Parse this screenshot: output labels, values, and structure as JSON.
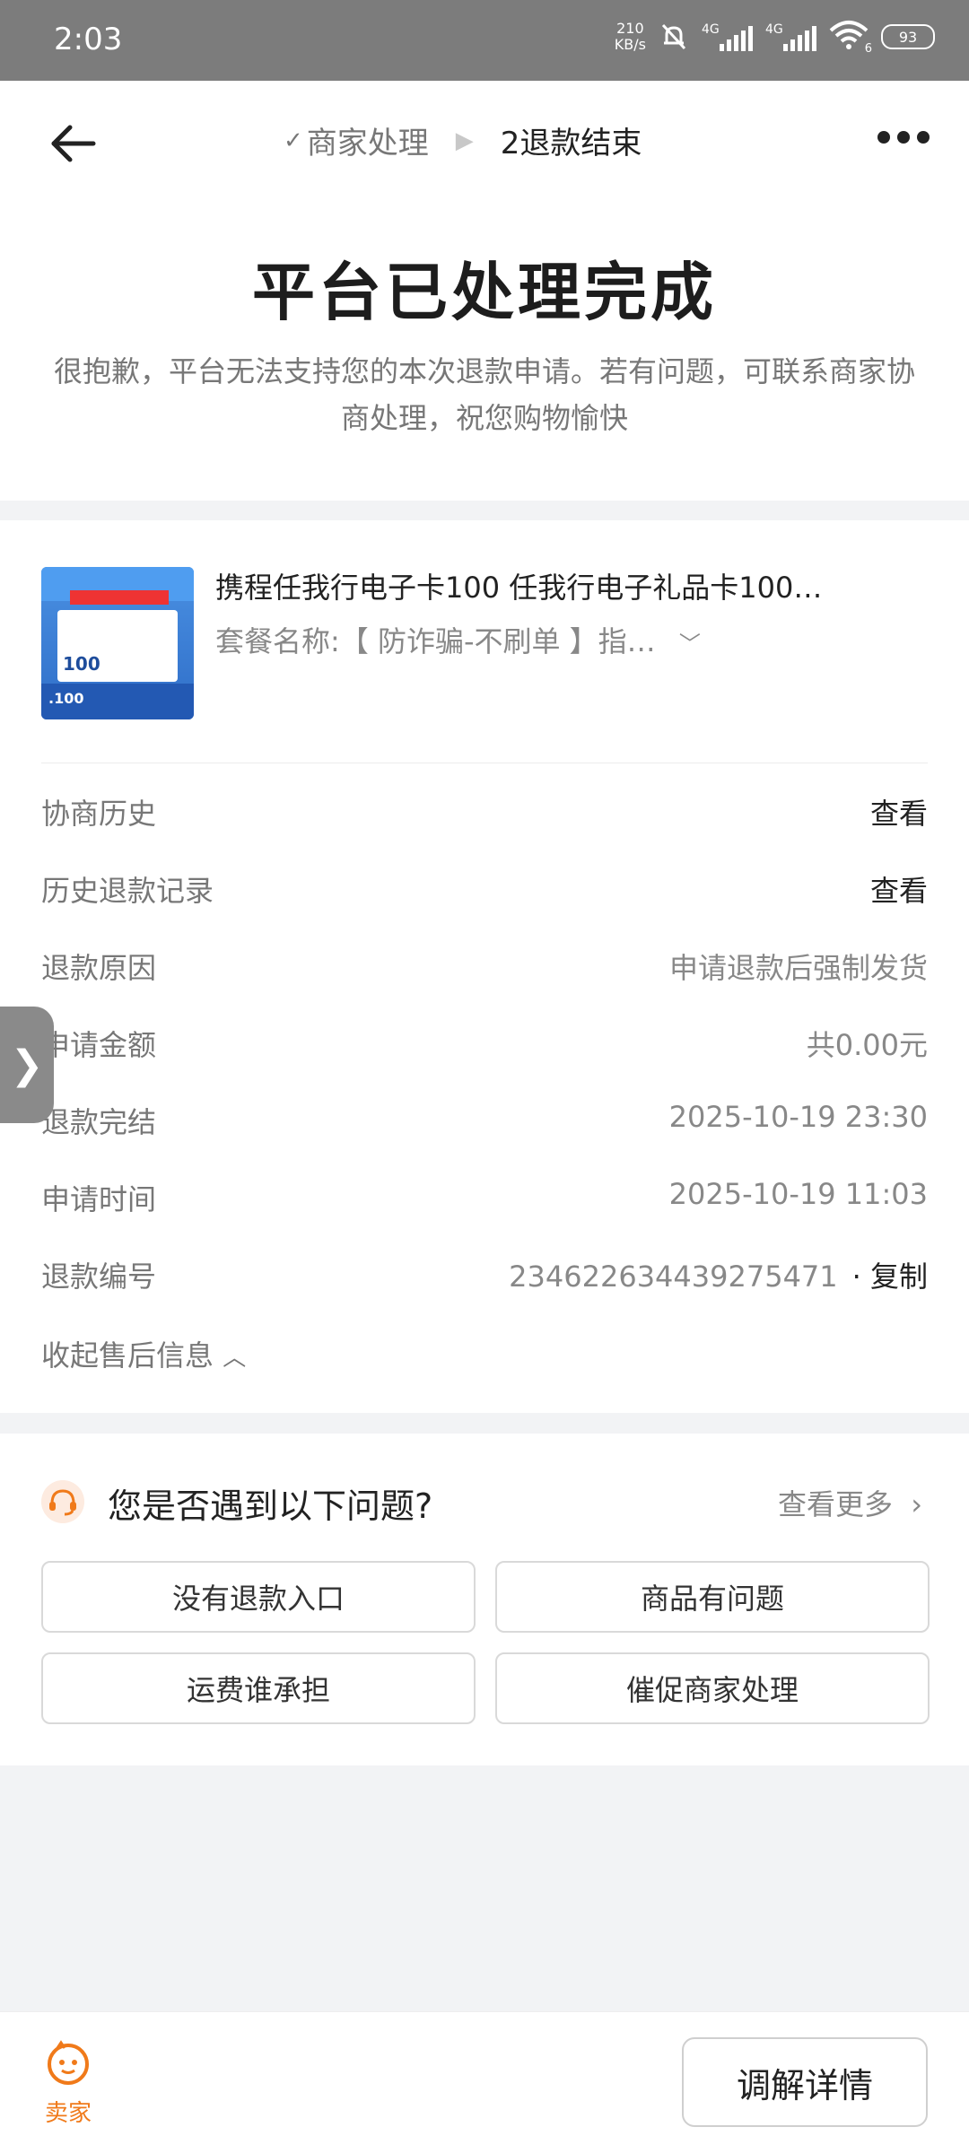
{
  "status_bar": {
    "time": "2:03",
    "net_speed_value": "210",
    "net_speed_unit": "KB/s",
    "signal1_label": "4G",
    "signal2_label": "4G",
    "wifi_label": "6",
    "battery": "93"
  },
  "nav": {
    "step1_check": "✓",
    "step1": "商家处理",
    "step2": "2退款结束"
  },
  "header": {
    "title": "平台已处理完成",
    "subtitle": "很抱歉，平台无法支持您的本次退款申请。若有问题，可联系商家协商处理，祝您购物愉快"
  },
  "product": {
    "title": "携程任我行电子卡100 任我行电子礼品卡100…",
    "package": "套餐名称:【 防诈骗-不刷单 】指…",
    "image_value": "100",
    "image_bottom_value": ".100"
  },
  "details": [
    {
      "label": "协商历史",
      "value": "查看"
    },
    {
      "label": "历史退款记录",
      "value": "查看"
    },
    {
      "label": "退款原因",
      "value": "申请退款后强制发货"
    },
    {
      "label": "申请金额",
      "value": "共0.00元"
    },
    {
      "label": "退款完结",
      "value": "2025-10-19 23:30"
    },
    {
      "label": "申请时间",
      "value": "2025-10-19 11:03"
    },
    {
      "label": "退款编号",
      "value": "2346226344392754​71"
    }
  ],
  "refund_number": "234622634439275471",
  "copy_label": "· 复制",
  "collapse_label": "收起售后信息",
  "side_tab": "❯",
  "questions": {
    "title": "您是否遇到以下问题?",
    "more": "查看更多",
    "buttons": [
      "没有退款入口",
      "商品有问题",
      "运费谁承担",
      "催促商家处理"
    ]
  },
  "bottom": {
    "seller_label": "卖家",
    "mediate_label": "调解详情"
  },
  "colors": {
    "accent_orange": "#f07a1a",
    "status_bar": "#7c7c7c"
  }
}
